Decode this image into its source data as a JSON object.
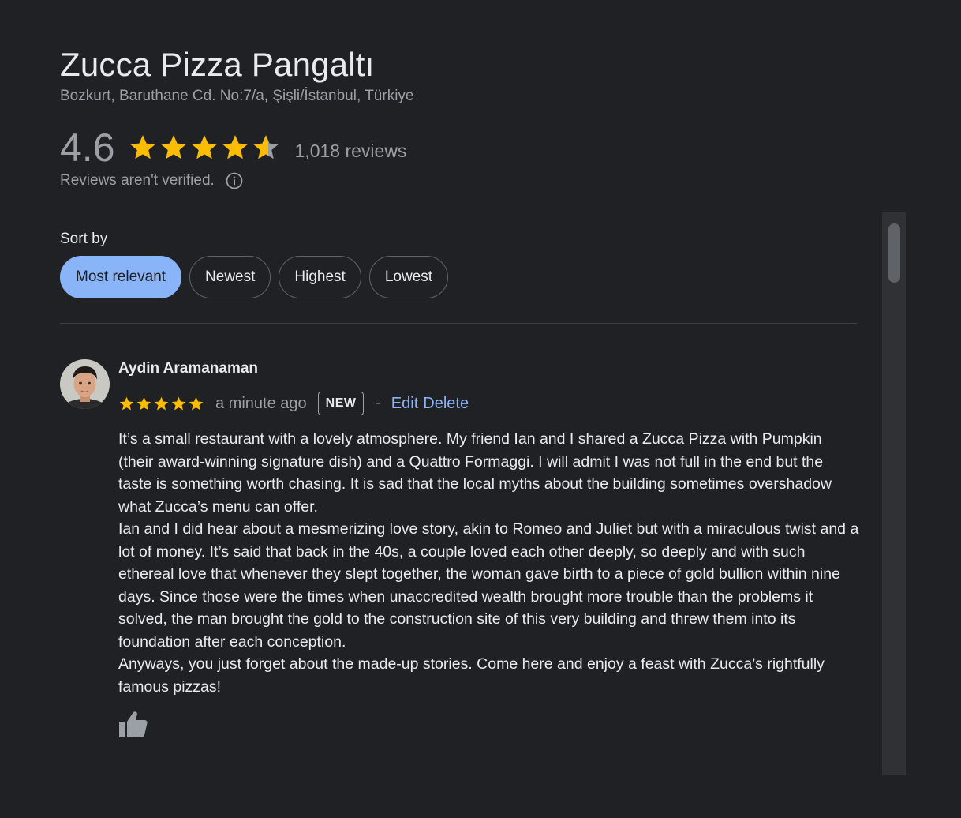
{
  "place": {
    "name": "Zucca Pizza Pangaltı",
    "address": "Bozkurt, Baruthane Cd. No:7/a, Şişli/İstanbul, Türkiye"
  },
  "rating": {
    "value": "4.6",
    "stars_filled": 4.6,
    "review_count": "1,018 reviews",
    "verification_note": "Reviews aren't verified.",
    "star_color": "#fbbc04",
    "star_empty_color": "#9aa0a6"
  },
  "sort": {
    "label": "Sort by",
    "options": [
      {
        "label": "Most relevant",
        "selected": true
      },
      {
        "label": "Newest",
        "selected": false
      },
      {
        "label": "Highest",
        "selected": false
      },
      {
        "label": "Lowest",
        "selected": false
      }
    ],
    "accent": "#8ab4f8"
  },
  "review": {
    "author": "Aydin Aramanaman",
    "stars": 5,
    "time": "a minute ago",
    "badge": "NEW",
    "separator": "-",
    "edit_label": "Edit",
    "delete_label": "Delete",
    "paragraphs": [
      "It’s a small restaurant with a lovely atmosphere. My friend Ian and I shared a Zucca Pizza with Pumpkin (their award-winning signature dish) and a Quattro Formaggi. I will admit I was not full in the end but the taste is something worth chasing. It is sad that the local myths about the building sometimes overshadow what Zucca’s menu can offer.",
      "Ian and I did hear about a mesmerizing love story, akin to Romeo and Juliet but with a miraculous twist and a lot of money. It’s said that back in the 40s, a couple loved each other deeply, so deeply and with such ethereal love that whenever they slept together, the woman gave birth to a piece of gold bullion within nine days. Since those were the times when unaccredited wealth brought more trouble than the problems it solved, the man brought the gold to the construction site of this very building and threw them into its foundation after each conception.",
      "Anyways, you just forget about the made-up stories. Come here and enjoy a feast with Zucca’s rightfully famous pizzas!"
    ],
    "like_icon": "thumbs-up-icon"
  }
}
